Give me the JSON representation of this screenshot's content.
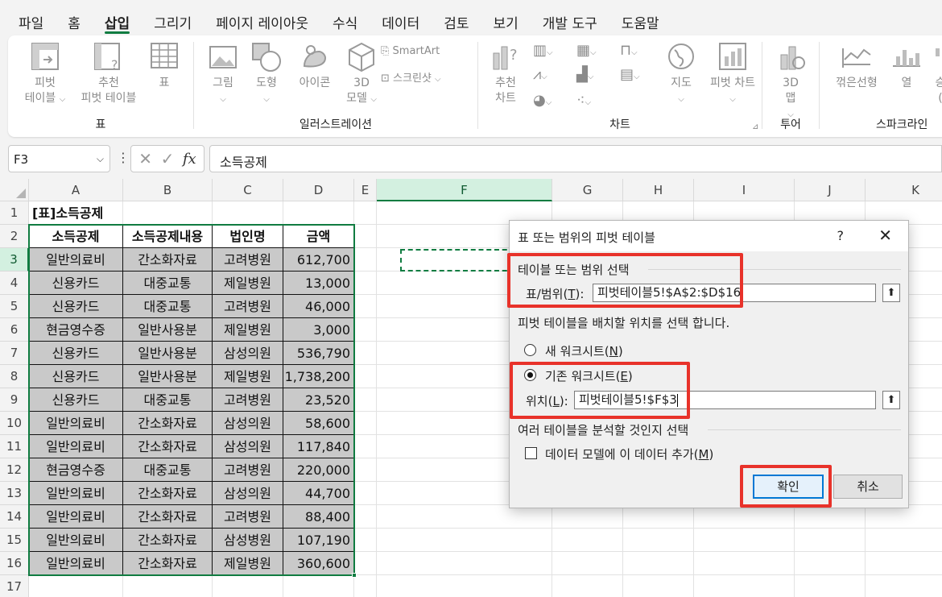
{
  "menu": [
    "파일",
    "홈",
    "삽입",
    "그리기",
    "페이지 레이아웃",
    "수식",
    "데이터",
    "검토",
    "보기",
    "개발 도구",
    "도움말"
  ],
  "menu_active_index": 2,
  "ribbon": {
    "groups": {
      "table": "표",
      "illustrations": "일러스트레이션",
      "charts": "차트",
      "tours": "투어",
      "sparklines": "스파크라인"
    },
    "buttons": {
      "pivot_line1": "피벗",
      "pivot_line2": "테이블",
      "rec_pivot_line1": "추천",
      "rec_pivot_line2": "피벗 테이블",
      "table": "표",
      "picture": "그림",
      "shape": "도형",
      "icon": "아이콘",
      "model3d_line1": "3D",
      "model3d_line2": "모델",
      "smartart": "SmartArt",
      "screenshot": "스크린샷",
      "rec_chart_line1": "추천",
      "rec_chart_line2": "차트",
      "map": "지도",
      "pivot_chart": "피벗 차트",
      "map3d_line1": "3D",
      "map3d_line2": "맵",
      "sparkline_line": "꺾은선형",
      "sparkline_column": "열",
      "sparkline_winloss_partial": "승",
      "sparkline_winloss_partial2": "("
    }
  },
  "formula_bar": {
    "name_box": "F3",
    "formula": "소득공제",
    "fx": "fx"
  },
  "columns": [
    "A",
    "B",
    "C",
    "D",
    "E",
    "F",
    "G",
    "H",
    "I",
    "J",
    "K"
  ],
  "rows": [
    "1",
    "2",
    "3",
    "4",
    "5",
    "6",
    "7",
    "8",
    "9",
    "10",
    "11",
    "12",
    "13",
    "14",
    "15",
    "16",
    "17"
  ],
  "sheet": {
    "title": "[표]소득공제",
    "headers": [
      "소득공제",
      "소득공제내용",
      "법인명",
      "금액"
    ],
    "data": [
      [
        "일반의료비",
        "간소화자료",
        "고려병원",
        "612,700"
      ],
      [
        "신용카드",
        "대중교통",
        "제일병원",
        "13,000"
      ],
      [
        "신용카드",
        "대중교통",
        "고려병원",
        "46,000"
      ],
      [
        "현금영수증",
        "일반사용분",
        "제일병원",
        "3,000"
      ],
      [
        "신용카드",
        "일반사용분",
        "삼성의원",
        "536,790"
      ],
      [
        "신용카드",
        "일반사용분",
        "제일병원",
        "1,738,200"
      ],
      [
        "신용카드",
        "대중교통",
        "고려병원",
        "23,520"
      ],
      [
        "일반의료비",
        "간소화자료",
        "삼성의원",
        "58,600"
      ],
      [
        "일반의료비",
        "간소화자료",
        "삼성의원",
        "117,840"
      ],
      [
        "현금영수증",
        "대중교통",
        "고려병원",
        "220,000"
      ],
      [
        "일반의료비",
        "간소화자료",
        "삼성의원",
        "44,700"
      ],
      [
        "일반의료비",
        "간소화자료",
        "고려병원",
        "88,400"
      ],
      [
        "일반의료비",
        "간소화자료",
        "삼성병원",
        "107,190"
      ],
      [
        "일반의료비",
        "간소화자료",
        "제일병원",
        "360,600"
      ]
    ]
  },
  "dialog": {
    "title": "표 또는 범위의 피벗 테이블",
    "help": "?",
    "close": "✕",
    "section1": "테이블 또는 범위 선택",
    "range_label": "표/범위(",
    "range_key": "T",
    "range_label_end": "):",
    "range_value": "피벗테이블5!$A$2:$D$16",
    "section2": "피벗 테이블을 배치할 위치를 선택 합니다.",
    "opt_new_label": "새 워크시트(",
    "opt_new_key": "N",
    "opt_new_end": ")",
    "opt_existing_label": "기존 워크시트(",
    "opt_existing_key": "E",
    "opt_existing_end": ")",
    "location_label": "위치(",
    "location_key": "L",
    "location_end": "):",
    "location_value": "피벗테이블5!$F$3",
    "section3": "여러 테이블을 분석할 것인지 선택",
    "datamodel_label": "데이터 모델에 이 데이터 추가(",
    "datamodel_key": "M",
    "datamodel_end": ")",
    "ok": "확인",
    "cancel": "취소"
  },
  "colors": {
    "accent": "#107c41",
    "highlight": "#e8322a",
    "table_fill": "#c9c9c9"
  }
}
